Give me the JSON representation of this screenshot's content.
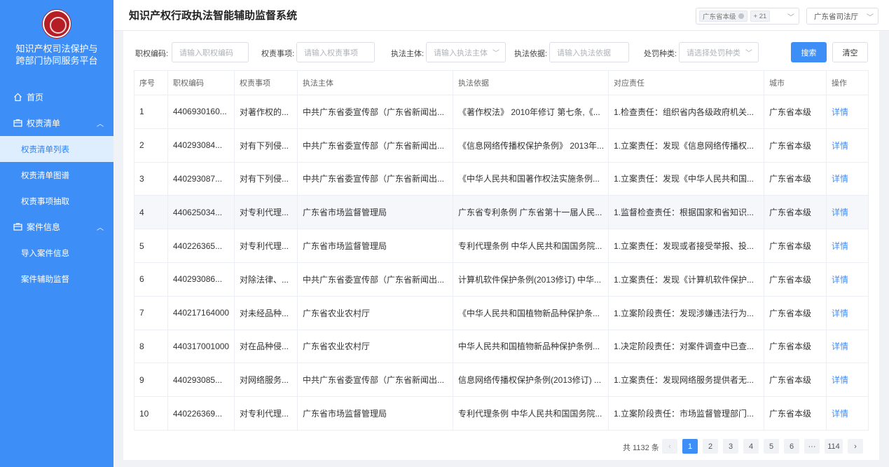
{
  "sidebar": {
    "title_line1": "知识产权司法保护与",
    "title_line2": "跨部门协同服务平台",
    "menu": [
      {
        "label": "首页",
        "icon": "home-icon"
      },
      {
        "label": "权责清单",
        "icon": "folder-icon"
      },
      {
        "label": "权责清单列表"
      },
      {
        "label": "权责清单图谱"
      },
      {
        "label": "权责事项抽取"
      },
      {
        "label": "案件信息",
        "icon": "folder-icon"
      },
      {
        "label": "导入案件信息"
      },
      {
        "label": "案件辅助监督"
      }
    ]
  },
  "header": {
    "title": "知识产权行政执法智能辅助监督系统",
    "city_tag": "广东省本级",
    "more_tag": "+ 21",
    "department": "广东省司法厅"
  },
  "filters": {
    "code_label": "职权编码:",
    "code_placeholder": "请输入职权编码",
    "item_label": "权责事项:",
    "item_placeholder": "请输入权责事项",
    "subject_label": "执法主体:",
    "subject_placeholder": "请输入执法主体",
    "basis_label": "执法依据:",
    "basis_placeholder": "请输入执法依据",
    "penalty_label": "处罚种类:",
    "penalty_placeholder": "请选择处罚种类",
    "search": "搜索",
    "clear": "清空"
  },
  "table": {
    "headers": [
      "序号",
      "职权编码",
      "权责事项",
      "执法主体",
      "执法依据",
      "对应责任",
      "城市",
      "操作"
    ],
    "rows": [
      [
        "1",
        "4406930160...",
        "对著作权的...",
        "中共广东省委宣传部（广东省新闻出...",
        "《著作权法》 2010年修订 第七条,《...",
        "1.检查责任：组织省内各级政府机关...",
        "广东省本级",
        "详情"
      ],
      [
        "2",
        "440293084...",
        "对有下列侵...",
        "中共广东省委宣传部（广东省新闻出...",
        "《信息网络传播权保护条例》 2013年...",
        "1.立案责任：发现《信息网络传播权...",
        "广东省本级",
        "详情"
      ],
      [
        "3",
        "440293087...",
        "对有下列侵...",
        "中共广东省委宣传部（广东省新闻出...",
        "《中华人民共和国著作权法实施条例...",
        "1.立案责任：发现《中华人民共和国...",
        "广东省本级",
        "详情"
      ],
      [
        "4",
        "440625034...",
        "对专利代理...",
        "广东省市场监督管理局",
        "广东省专利条例 广东省第十一届人民...",
        "1.监督检查责任：根据国家和省知识...",
        "广东省本级",
        "详情"
      ],
      [
        "5",
        "440226365...",
        "对专利代理...",
        "广东省市场监督管理局",
        "专利代理条例 中华人民共和国国务院...",
        "1.立案责任：发现或者接受举报、投...",
        "广东省本级",
        "详情"
      ],
      [
        "6",
        "440293086...",
        "对除法律、...",
        "中共广东省委宣传部（广东省新闻出...",
        "计算机软件保护条例(2013修订) 中华...",
        "1.立案责任：发现《计算机软件保护...",
        "广东省本级",
        "详情"
      ],
      [
        "7",
        "440217164000",
        "对未经品种...",
        "广东省农业农村厅",
        "《中华人民共和国植物新品种保护条...",
        "1.立案阶段责任：发现涉嫌违法行为...",
        "广东省本级",
        "详情"
      ],
      [
        "8",
        "440317001000",
        "对在品种侵...",
        "广东省农业农村厅",
        "中华人民共和国植物新品种保护条例...",
        "1.决定阶段责任：对案件调查中已查...",
        "广东省本级",
        "详情"
      ],
      [
        "9",
        "440293085...",
        "对网络服务...",
        "中共广东省委宣传部（广东省新闻出...",
        "信息网络传播权保护条例(2013修订) ...",
        "1.立案责任：发现网络服务提供者无...",
        "广东省本级",
        "详情"
      ],
      [
        "10",
        "440226369...",
        "对专利代理...",
        "广东省市场监督管理局",
        "专利代理条例 中华人民共和国国务院...",
        "1.立案阶段责任：市场监督管理部门...",
        "广东省本级",
        "详情"
      ]
    ]
  },
  "pagination": {
    "total": "共 1132 条",
    "prev": "‹",
    "pages": [
      "1",
      "2",
      "3",
      "4",
      "5",
      "6",
      "···",
      "114"
    ],
    "next": "›",
    "current": 1
  }
}
